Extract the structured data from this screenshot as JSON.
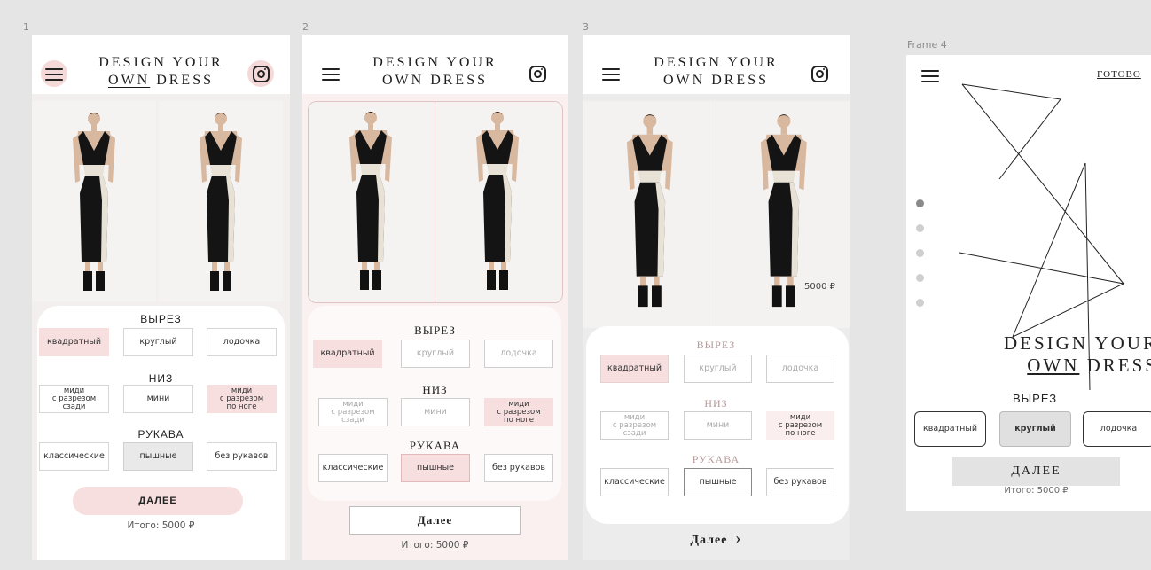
{
  "frames": {
    "f1": {
      "label": "1"
    },
    "f2": {
      "label": "2"
    },
    "f3": {
      "label": "3",
      "price": "5000 ₽"
    },
    "f4": {
      "label": "Frame 4",
      "ready": "ГОТОВО"
    }
  },
  "header": {
    "line1": "DESIGN YOUR",
    "own": "OWN",
    "dress": "DRESS",
    "line2": "OWN DRESS"
  },
  "sections": {
    "neck": "ВЫРЕЗ",
    "bottom": "НИЗ",
    "sleeves": "РУКАВА"
  },
  "options": {
    "neck": [
      "квадратный",
      "круглый",
      "лодочка"
    ],
    "bottom": [
      "миди\nс разрезом\nсзади",
      "мини",
      "миди\nс разрезом\nпо ноге"
    ],
    "sleeves": [
      "классические",
      "пышные",
      "без рукавов"
    ]
  },
  "next": {
    "caps": "ДАЛЕЕ",
    "text": "Далее",
    "arrow": "›"
  },
  "total": "Итого: 5000 ₽",
  "slider": {
    "dots": 5,
    "active": 1
  },
  "colors": {
    "accent": "#f7dedf",
    "background": "#e5e5e5"
  }
}
